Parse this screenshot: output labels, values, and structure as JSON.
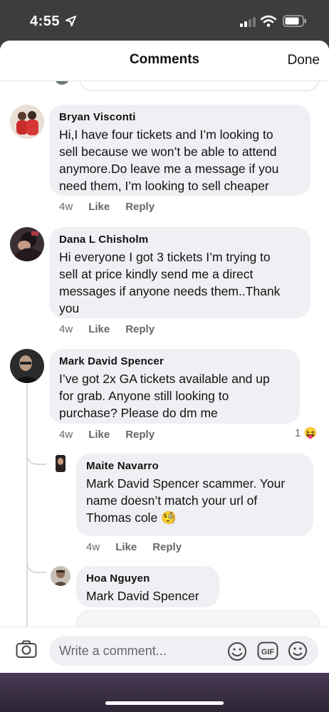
{
  "status_bar": {
    "time": "4:55"
  },
  "header": {
    "title": "Comments",
    "done_label": "Done"
  },
  "comments": [
    {
      "author": "Bryan Visconti",
      "text": "Hi,I have four tickets and I’m looking to\nsell because we won’t be able to attend\nanymore.Do leave me a message if you\nneed them, I’m looking to sell cheaper",
      "age": "4w",
      "like": "Like",
      "reply": "Reply"
    },
    {
      "author": "Dana L Chisholm",
      "text": "Hi everyone I got 3 tickets I’m trying to\nsell at  price kindly send me a direct\nmessages if anyone needs them..Thank\nyou",
      "age": "4w",
      "like": "Like",
      "reply": "Reply"
    },
    {
      "author": "Mark David Spencer",
      "text": "I’ve got 2x GA tickets available and up\nfor grab. Anyone still looking to\npurchase? Please do dm me",
      "age": "4w",
      "like": "Like",
      "reply": "Reply",
      "reaction_count": "1",
      "reaction_emoji": "😝"
    }
  ],
  "replies": [
    {
      "author": "Maite Navarro",
      "text": "Mark David Spencer scammer. Your\nname doesn’t match your url of\nThomas cole",
      "emoji": "🧐",
      "age": "4w",
      "like": "Like",
      "reply": "Reply"
    },
    {
      "author": "Hoa Nguyen",
      "text": "Mark David Spencer"
    }
  ],
  "composer": {
    "placeholder": "Write a comment..."
  },
  "colors": {
    "bubble": "#eff0f3",
    "meta": "#65676b",
    "emoji": "#f7c948"
  }
}
